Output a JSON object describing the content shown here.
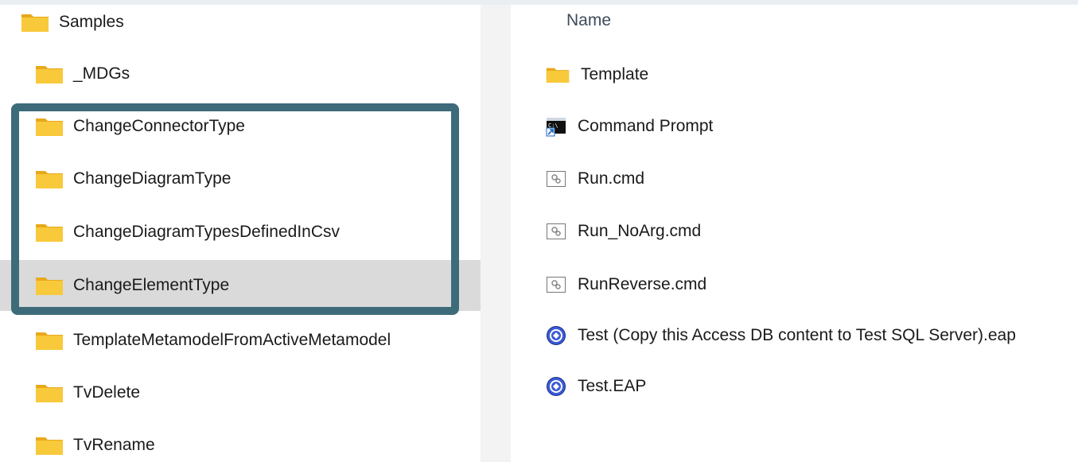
{
  "nav": {
    "items": [
      {
        "label": "Samples"
      },
      {
        "label": "_MDGs"
      },
      {
        "label": "ChangeConnectorType"
      },
      {
        "label": "ChangeDiagramType"
      },
      {
        "label": "ChangeDiagramTypesDefinedInCsv"
      },
      {
        "label": "ChangeElementType",
        "selected": true
      },
      {
        "label": "TemplateMetamodelFromActiveMetamodel"
      },
      {
        "label": "TvDelete"
      },
      {
        "label": "TvRename"
      }
    ]
  },
  "content": {
    "column_name": "Name",
    "files": [
      {
        "label": "Template",
        "icon": "folder-icon"
      },
      {
        "label": "Command Prompt",
        "icon": "command-prompt-shortcut-icon"
      },
      {
        "label": "Run.cmd",
        "icon": "cmd-script-icon"
      },
      {
        "label": "Run_NoArg.cmd",
        "icon": "cmd-script-icon"
      },
      {
        "label": "RunReverse.cmd",
        "icon": "cmd-script-icon"
      },
      {
        "label": "Test (Copy this Access DB content to Test SQL Server).eap",
        "icon": "eap-file-icon"
      },
      {
        "label": "Test.EAP",
        "icon": "eap-file-icon"
      }
    ]
  },
  "colors": {
    "highlight_border": "#3d6b7a",
    "selected_bg": "#dadada",
    "folder_yellow": "#f8c93a"
  }
}
